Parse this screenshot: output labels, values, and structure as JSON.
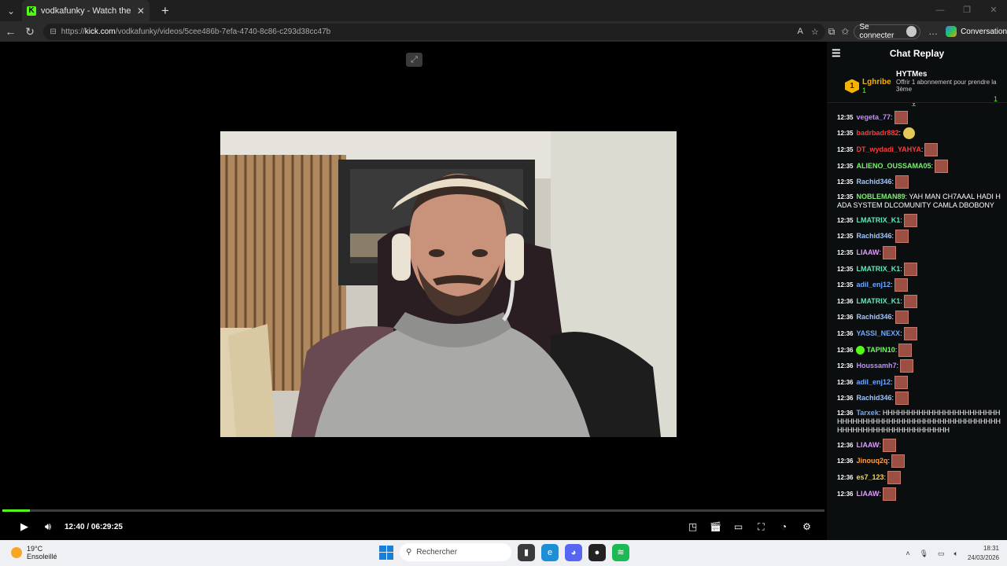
{
  "browser": {
    "tab_title": "vodkafunky - Watch the VOD on K",
    "favicon_letter": "K",
    "url_prefix": "https://",
    "url_host": "kick.com",
    "url_path": "/vodkafunky/videos/5cee486b-7efa-4740-8c86-c293d38cc47b",
    "signin_label": "Se connecter",
    "copilot_label": "Conversation"
  },
  "player": {
    "progress_fraction": 0.0331,
    "current_time": "12:40",
    "separator": "/",
    "duration": "06:29:25",
    "accent_color": "#53fc18"
  },
  "chat": {
    "title": "Chat Replay",
    "pinned": {
      "left_rank": "1",
      "left_name": "Lghribe",
      "left_count": "1",
      "right_name": "HYTMes",
      "right_desc": "Offrir 1 abonnement pour prendre la 3ème",
      "right_count": "1"
    },
    "messages": [
      {
        "ts": "12:35",
        "user": "vegeta_77",
        "color": "#c38bff",
        "emote": "box"
      },
      {
        "ts": "12:35",
        "user": "badrbadr882",
        "color": "#ff3b3b",
        "emote": "face"
      },
      {
        "ts": "12:35",
        "user": "DT_wydadi_YAHYA",
        "color": "#ff3b3b",
        "emote": "box"
      },
      {
        "ts": "12:35",
        "user": "ALIENO_OUSSAMA05",
        "color": "#7bf06e",
        "emote": "box"
      },
      {
        "ts": "12:35",
        "user": "Rachid346",
        "color": "#9fc5ff",
        "emote": "box"
      },
      {
        "ts": "12:35",
        "user": "NOBLEMAN89",
        "color": "#7bf06e",
        "text": "YAH MAN CH7AAAL HADI HADA SYSTEM DLCOMUNITY CAMLA DBOBONY"
      },
      {
        "ts": "12:35",
        "user": "LMATRIX_K1",
        "color": "#5ee8c4",
        "emote": "box"
      },
      {
        "ts": "12:35",
        "user": "Rachid346",
        "color": "#9fc5ff",
        "emote": "box"
      },
      {
        "ts": "12:35",
        "user": "LIAAW",
        "color": "#e09cff",
        "emote": "box"
      },
      {
        "ts": "12:35",
        "user": "LMATRIX_K1",
        "color": "#5ee8c4",
        "emote": "box"
      },
      {
        "ts": "12:35",
        "user": "adil_enj12",
        "color": "#6fa8ff",
        "emote": "box"
      },
      {
        "ts": "12:36",
        "user": "LMATRIX_K1",
        "color": "#5ee8c4",
        "emote": "box"
      },
      {
        "ts": "12:36",
        "user": "Rachid346",
        "color": "#9fc5ff",
        "emote": "box"
      },
      {
        "ts": "12:36",
        "user": "YASSI_NEXX",
        "color": "#6fa8ff",
        "emote": "box"
      },
      {
        "ts": "12:36",
        "user": "TAPIN10",
        "color": "#7bf06e",
        "emote": "box",
        "verified": true
      },
      {
        "ts": "12:36",
        "user": "Houssamh7",
        "color": "#c38bff",
        "emote": "box"
      },
      {
        "ts": "12:36",
        "user": "adil_enj12",
        "color": "#6fa8ff",
        "emote": "box"
      },
      {
        "ts": "12:36",
        "user": "Rachid346",
        "color": "#9fc5ff",
        "emote": "box"
      },
      {
        "ts": "12:36",
        "user": "Tarxek",
        "color": "#6fa8ff",
        "text": "HHHHHHHHHHHHHHHHHHHHHHHHHHHHHHHHHHHHHHHHHHHHHHHHHHHHHHHHHHHHHHHHHHHHHHHHHHHHH"
      },
      {
        "ts": "12:36",
        "user": "LIAAW",
        "color": "#e09cff",
        "emote": "box"
      },
      {
        "ts": "12:36",
        "user": "Jinouq2q",
        "color": "#ff9f43",
        "emote": "box"
      },
      {
        "ts": "12:36",
        "user": "es7_123",
        "color": "#ffd24d",
        "emote": "box"
      },
      {
        "ts": "12:36",
        "user": "LIAAW",
        "color": "#e09cff",
        "emote": "box"
      }
    ]
  },
  "taskbar": {
    "temperature": "19°C",
    "weather": "Ensoleillé",
    "search_placeholder": "Rechercher",
    "time": "18:31",
    "date": "24/03/2026"
  }
}
